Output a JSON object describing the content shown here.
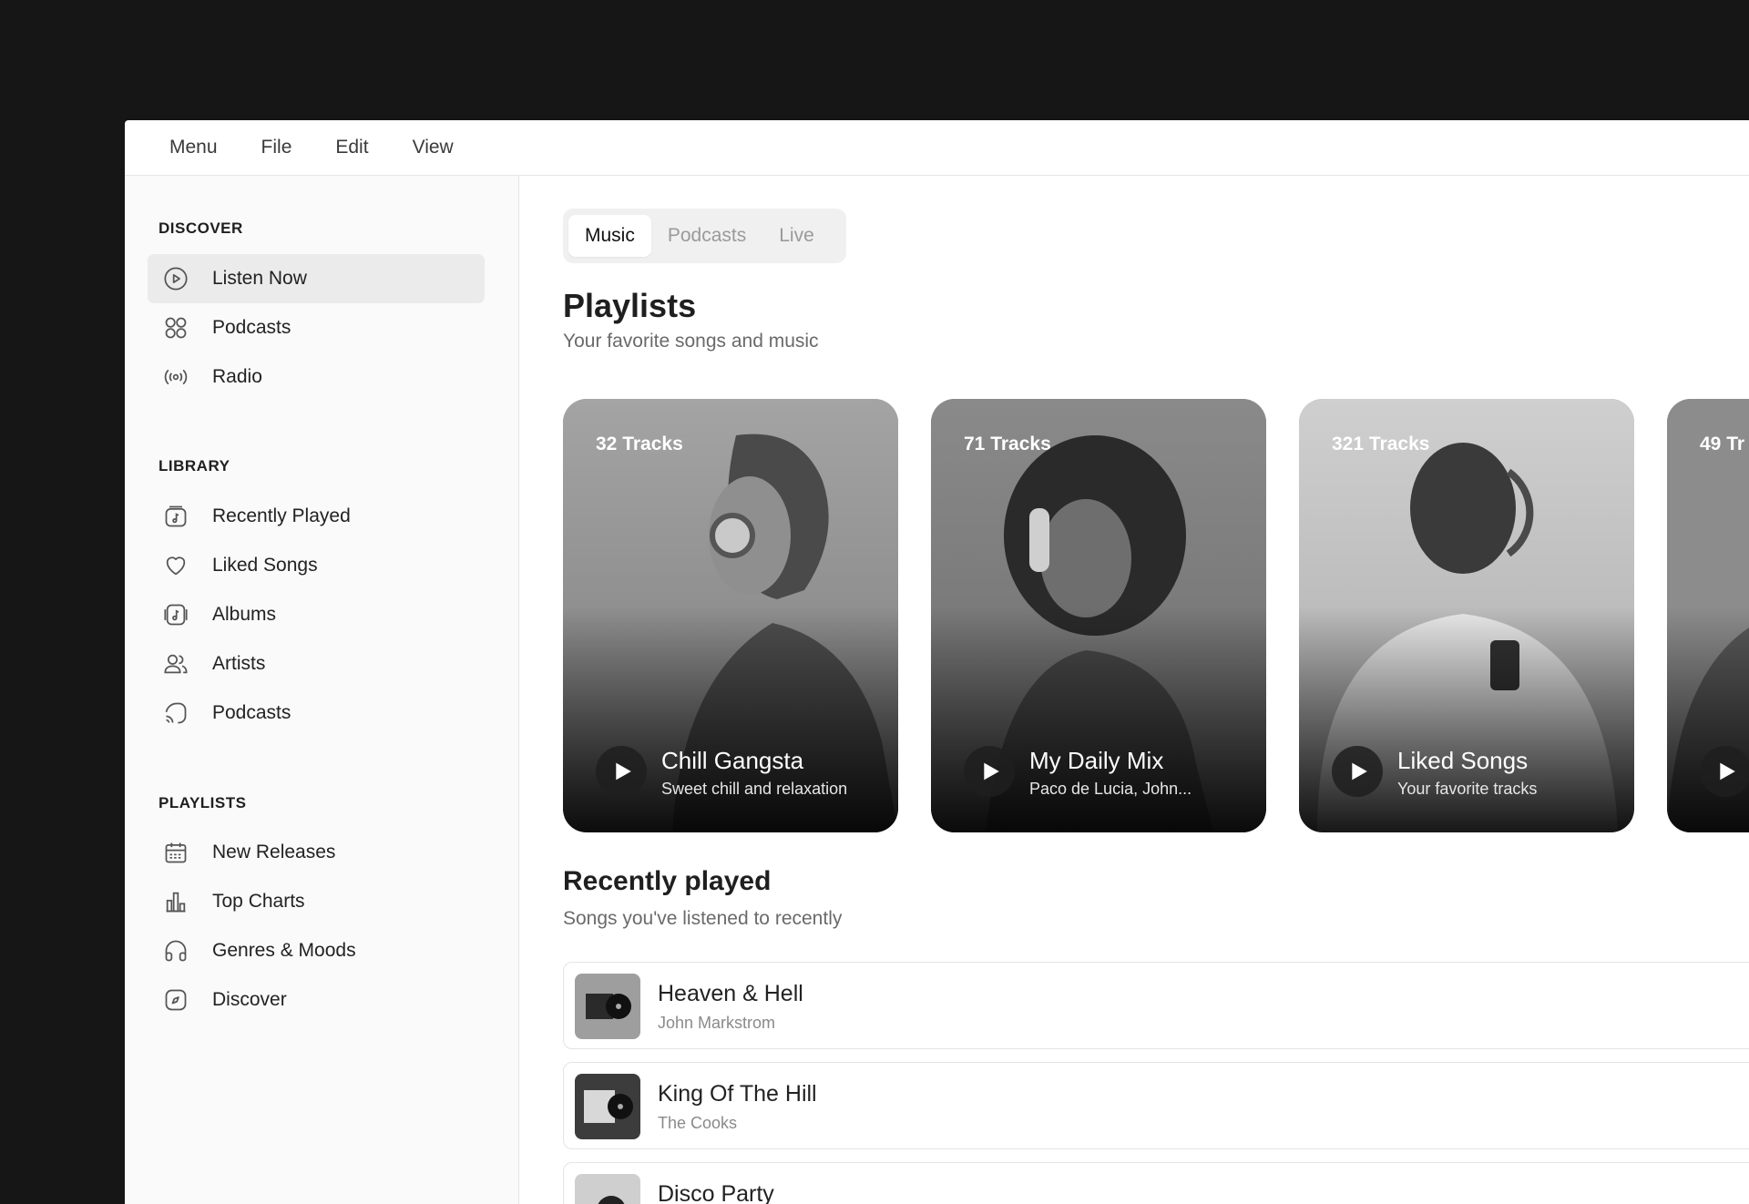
{
  "menubar": {
    "items": [
      "Menu",
      "File",
      "Edit",
      "View"
    ]
  },
  "sidebar": {
    "discover": {
      "title": "DISCOVER",
      "items": [
        {
          "label": "Listen Now",
          "icon": "play-circle-icon",
          "active": true
        },
        {
          "label": "Podcasts",
          "icon": "grid-icon"
        },
        {
          "label": "Radio",
          "icon": "radio-icon"
        }
      ]
    },
    "library": {
      "title": "LIBRARY",
      "items": [
        {
          "label": "Recently Played",
          "icon": "music-box-icon"
        },
        {
          "label": "Liked Songs",
          "icon": "heart-icon"
        },
        {
          "label": "Albums",
          "icon": "album-icon"
        },
        {
          "label": "Artists",
          "icon": "users-icon"
        },
        {
          "label": "Podcasts",
          "icon": "podcast-icon"
        }
      ]
    },
    "playlists": {
      "title": "PLAYLISTS",
      "items": [
        {
          "label": "New Releases",
          "icon": "calendar-icon"
        },
        {
          "label": "Top Charts",
          "icon": "bar-chart-icon"
        },
        {
          "label": "Genres & Moods",
          "icon": "headphones-icon"
        },
        {
          "label": "Discover",
          "icon": "compass-icon"
        }
      ]
    }
  },
  "tabs": [
    {
      "label": "Music",
      "active": true
    },
    {
      "label": "Podcasts"
    },
    {
      "label": "Live"
    }
  ],
  "playlists_section": {
    "title": "Playlists",
    "subtitle": "Your favorite songs and music",
    "cards": [
      {
        "tracks": "32 Tracks",
        "title": "Chill Gangsta",
        "desc": "Sweet chill and relaxation"
      },
      {
        "tracks": "71 Tracks",
        "title": "My Daily Mix",
        "desc": "Paco de Lucia, John..."
      },
      {
        "tracks": "321 Tracks",
        "title": "Liked Songs",
        "desc": "Your favorite tracks"
      },
      {
        "tracks": "49 Tr",
        "title": "",
        "desc": ""
      }
    ]
  },
  "recent_section": {
    "title": "Recently played",
    "subtitle": "Songs you've listened to recently",
    "rows": [
      {
        "title": "Heaven & Hell",
        "artist": "John Markstrom"
      },
      {
        "title": "King Of The Hill",
        "artist": "The Cooks"
      },
      {
        "title": "Disco Party",
        "artist": ""
      }
    ]
  },
  "icons": {
    "play": "play-icon"
  }
}
